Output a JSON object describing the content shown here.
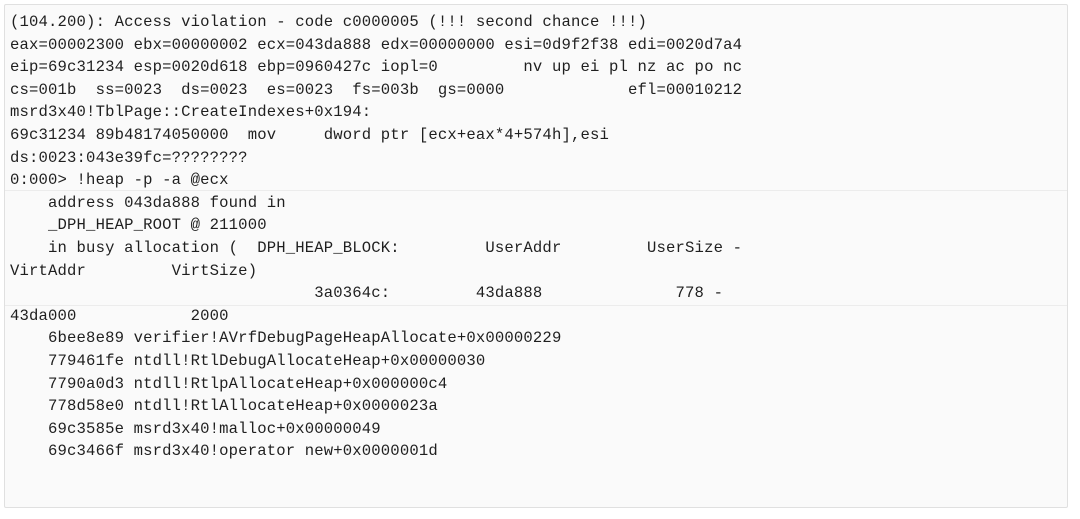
{
  "window": {
    "kind": "debugger-console-output",
    "border_color": "#e0e0e0",
    "background_color": "#fafafa",
    "text_color": "#1f1f1f"
  },
  "console": {
    "lines": [
      "(104.200): Access violation - code c0000005 (!!! second chance !!!)",
      "eax=00002300 ebx=00000002 ecx=043da888 edx=00000000 esi=0d9f2f38 edi=0020d7a4",
      "eip=69c31234 esp=0020d618 ebp=0960427c iopl=0         nv up ei pl nz ac po nc",
      "cs=001b  ss=0023  ds=0023  es=0023  fs=003b  gs=0000             efl=00010212",
      "msrd3x40!TblPage::CreateIndexes+0x194:",
      "69c31234 89b48174050000  mov     dword ptr [ecx+eax*4+574h],esi",
      "ds:0023:043e39fc=????????",
      "0:000> !heap -p -a @ecx",
      "    address 043da888 found in",
      "    _DPH_HEAP_ROOT @ 211000",
      "    in busy allocation (  DPH_HEAP_BLOCK:         UserAddr         UserSize -",
      "VirtAddr         VirtSize)",
      "                                3a0364c:         43da888              778 -",
      "43da000            2000",
      "    6bee8e89 verifier!AVrfDebugPageHeapAllocate+0x00000229",
      "    779461fe ntdll!RtlDebugAllocateHeap+0x00000030",
      "    7790a0d3 ntdll!RtlpAllocateHeap+0x000000c4",
      "    778d58e0 ntdll!RtlAllocateHeap+0x0000023a",
      "    69c3585e msrd3x40!malloc+0x00000049",
      "    69c3466f msrd3x40!operator new+0x0000001d"
    ],
    "exception": {
      "process_thread": "104.200",
      "description": "Access violation",
      "code": "c0000005",
      "chance": "!!! second chance !!!"
    },
    "registers": {
      "eax": "00002300",
      "ebx": "00000002",
      "ecx": "043da888",
      "edx": "00000000",
      "esi": "0d9f2f38",
      "edi": "0020d7a4",
      "eip": "69c31234",
      "esp": "0020d618",
      "ebp": "0960427c",
      "iopl": "0",
      "cs": "001b",
      "ss": "0023",
      "ds": "0023",
      "es": "0023",
      "fs": "003b",
      "gs": "0000",
      "efl": "00010212",
      "flags": "nv up ei pl nz ac po nc"
    },
    "faulting_symbol": "msrd3x40!TblPage::CreateIndexes+0x194:",
    "disassembly": {
      "address": "69c31234",
      "opcodes": "89b48174050000",
      "mnemonic": "mov",
      "operands": "dword ptr [ecx+eax*4+574h],esi",
      "memory_ref": "ds:0023:043e39fc=????????"
    },
    "prompt": "0:000>",
    "command": "!heap -p -a @ecx",
    "heap": {
      "found_address": "043da888",
      "dph_heap_root": "211000",
      "state": "in busy allocation",
      "columns": [
        "DPH_HEAP_BLOCK:",
        "UserAddr",
        "UserSize -",
        "VirtAddr",
        "VirtSize)"
      ],
      "block": "3a0364c:",
      "user_addr": "43da888",
      "user_size": "778 -",
      "virt_addr": "43da000",
      "virt_size": "2000"
    },
    "stack_frames": [
      {
        "address": "6bee8e89",
        "symbol": "verifier!AVrfDebugPageHeapAllocate+0x00000229"
      },
      {
        "address": "779461fe",
        "symbol": "ntdll!RtlDebugAllocateHeap+0x00000030"
      },
      {
        "address": "7790a0d3",
        "symbol": "ntdll!RtlpAllocateHeap+0x000000c4"
      },
      {
        "address": "778d58e0",
        "symbol": "ntdll!RtlAllocateHeap+0x0000023a"
      },
      {
        "address": "69c3585e",
        "symbol": "msrd3x40!malloc+0x00000049"
      },
      {
        "address": "69c3466f",
        "symbol": "msrd3x40!operator new+0x0000001d"
      }
    ]
  }
}
